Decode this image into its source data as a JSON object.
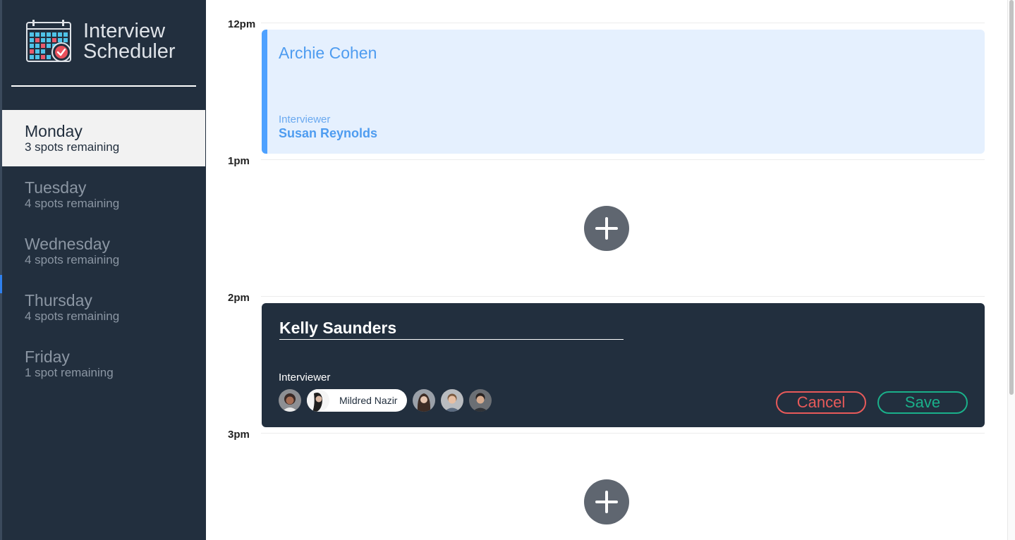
{
  "app": {
    "title_line1": "Interview",
    "title_line2": "Scheduler"
  },
  "days": [
    {
      "name": "Monday",
      "spots": "3 spots remaining",
      "selected": true
    },
    {
      "name": "Tuesday",
      "spots": "4 spots remaining",
      "selected": false
    },
    {
      "name": "Wednesday",
      "spots": "4 spots remaining",
      "selected": false
    },
    {
      "name": "Thursday",
      "spots": "4 spots remaining",
      "selected": false
    },
    {
      "name": "Friday",
      "spots": "1 spot remaining",
      "selected": false
    }
  ],
  "schedule": {
    "hours": [
      "12pm",
      "1pm",
      "2pm",
      "3pm"
    ],
    "booked": {
      "student": "Archie Cohen",
      "interviewer_label": "Interviewer",
      "interviewer": "Susan Reynolds"
    },
    "form": {
      "student_value": "Kelly Saunders",
      "interviewer_label": "Interviewer",
      "selected_interviewer": "Mildred Nazir",
      "cancel_label": "Cancel",
      "save_label": "Save"
    }
  },
  "colors": {
    "sidebar": "#222f3e",
    "booked_bg": "#e5f0fe",
    "booked_accent": "#4ea1ff",
    "cancel": "#e85a5a",
    "save": "#1ab08a"
  }
}
